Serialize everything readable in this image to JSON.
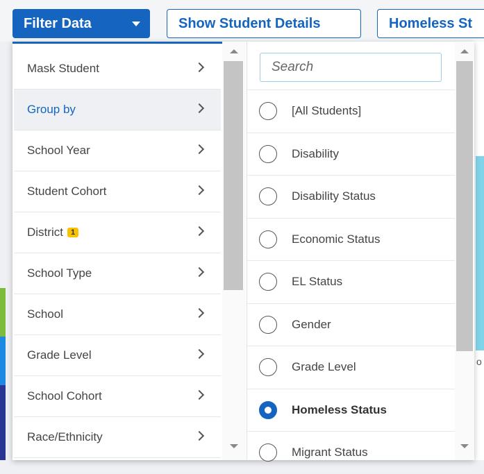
{
  "toolbar": {
    "filter_label": "Filter Data",
    "student_details_label": "Show Student Details",
    "homeless_label": "Homeless St"
  },
  "background": {
    "right_fragment": "o"
  },
  "filter_menu": {
    "items": [
      {
        "label": "Mask Student"
      },
      {
        "label": "Group by",
        "active": true
      },
      {
        "label": "School Year"
      },
      {
        "label": "Student Cohort"
      },
      {
        "label": "District",
        "badge": "1"
      },
      {
        "label": "School Type"
      },
      {
        "label": "School"
      },
      {
        "label": "Grade Level"
      },
      {
        "label": "School Cohort"
      },
      {
        "label": "Race/Ethnicity"
      }
    ]
  },
  "group_by": {
    "search_placeholder": "Search",
    "options": [
      {
        "label": "[All Students]"
      },
      {
        "label": "Disability"
      },
      {
        "label": "Disability Status"
      },
      {
        "label": "Economic Status"
      },
      {
        "label": "EL Status"
      },
      {
        "label": "Gender"
      },
      {
        "label": "Grade Level"
      },
      {
        "label": "Homeless Status",
        "selected": true
      },
      {
        "label": "Migrant Status"
      }
    ]
  },
  "colors": {
    "accent": "#1565c0",
    "badge": "#f7c200"
  }
}
